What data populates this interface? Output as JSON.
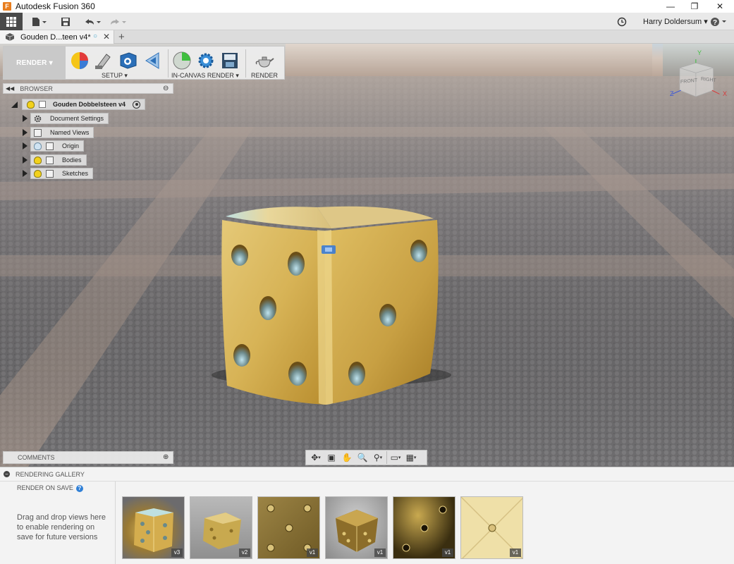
{
  "window": {
    "title": "Autodesk Fusion 360",
    "app_icon_letter": "F"
  },
  "quick_access": {
    "user": "Harry Doldersum"
  },
  "document_tab": {
    "name": "Gouden D...teen v4*"
  },
  "toolbar": {
    "workspace": "RENDER",
    "groups": [
      {
        "label": "SETUP"
      },
      {
        "label": "IN-CANVAS RENDER"
      },
      {
        "label": "RENDER"
      }
    ]
  },
  "browser": {
    "header": "BROWSER",
    "root": "Gouden Dobbelsteen v4",
    "items": [
      {
        "label": "Document Settings",
        "icon": "gear-icon"
      },
      {
        "label": "Named Views",
        "icon": "folder-icon"
      },
      {
        "label": "Origin",
        "icon": "bulb-off-icon"
      },
      {
        "label": "Bodies",
        "icon": "bulb-on-icon"
      },
      {
        "label": "Sketches",
        "icon": "bulb-on-icon"
      }
    ]
  },
  "comments": {
    "header": "COMMENTS"
  },
  "viewcube": {
    "front": "FRONT",
    "right": "RIGHT",
    "axis_z": "Z",
    "axis_x": "X",
    "axis_y": "Y"
  },
  "gallery": {
    "header": "RENDERING GALLERY",
    "render_on_save": "RENDER ON SAVE",
    "hint": "Drag and drop views here to enable rendering on save for future versions",
    "thumbnails": [
      {
        "version": "v3"
      },
      {
        "version": "v2"
      },
      {
        "version": "v1"
      },
      {
        "version": "v1"
      },
      {
        "version": "v1"
      },
      {
        "version": "v1"
      }
    ]
  },
  "colors": {
    "workspace_bg": "#c9c9c9",
    "gold": "#d8b456",
    "accent_blue": "#2f7fd6"
  }
}
